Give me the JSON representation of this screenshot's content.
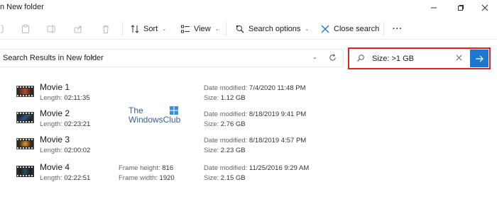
{
  "window": {
    "title": "n New folder"
  },
  "toolbar": {
    "sort_label": "Sort",
    "view_label": "View",
    "search_options_label": "Search options",
    "close_search_label": "Close search",
    "more_label": "···"
  },
  "address": {
    "path": "Search Results in New folder",
    "separator": "›"
  },
  "search": {
    "value": "Size: >1 GB",
    "highlight_color": "#e02424",
    "accent": "#1d77d1"
  },
  "results": [
    {
      "name": "Movie 1",
      "length_label": "Length:",
      "length": "02:11:35",
      "date_label": "Date modified:",
      "date": "7/4/2020 11:48 PM",
      "size_label": "Size:",
      "size": "1.12 GB"
    },
    {
      "name": "Movie 2",
      "length_label": "Length:",
      "length": "02:23:21",
      "date_label": "Date modified:",
      "date": "8/18/2019 9:41 PM",
      "size_label": "Size:",
      "size": "2.76 GB"
    },
    {
      "name": "Movie 3",
      "length_label": "Length:",
      "length": "02:00:02",
      "date_label": "Date modified:",
      "date": "8/18/2019 4:57 PM",
      "size_label": "Size:",
      "size": "2.23 GB"
    },
    {
      "name": "Movie 4",
      "length_label": "Length:",
      "length": "02:22:51",
      "frame_height_label": "Frame height:",
      "frame_height": "816",
      "frame_width_label": "Frame width:",
      "frame_width": "1920",
      "date_label": "Date modified:",
      "date": "11/25/2016 9:29 AM",
      "size_label": "Size:",
      "size": "2.15 GB"
    }
  ],
  "watermark": {
    "line1": "The",
    "line2": "WindowsClub"
  }
}
